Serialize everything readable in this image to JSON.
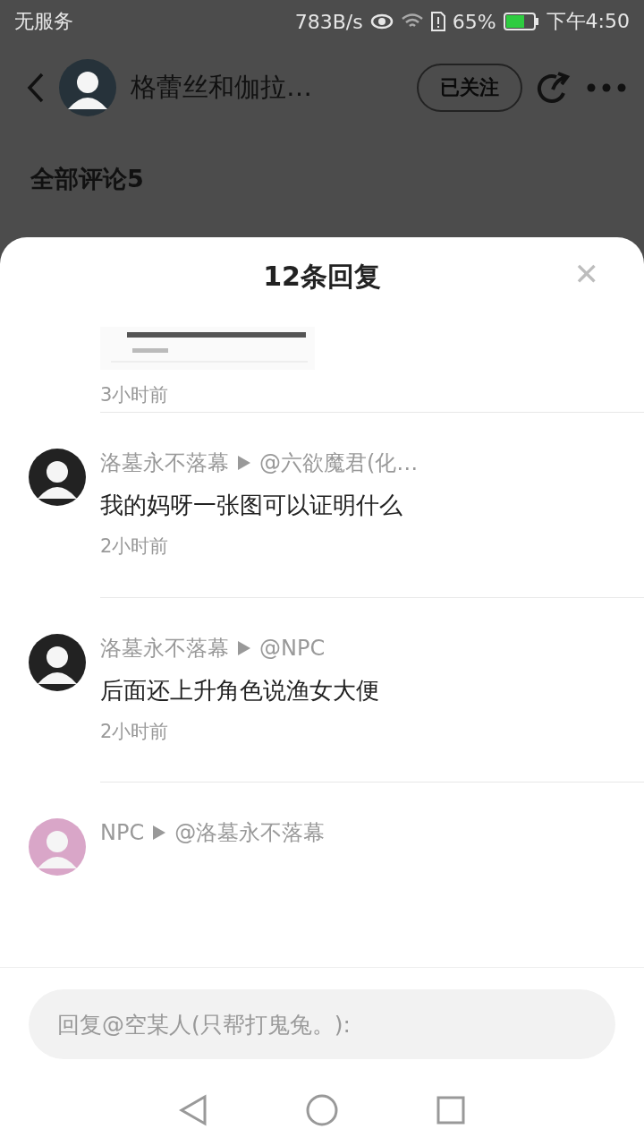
{
  "status_bar": {
    "carrier": "无服务",
    "speed": "783B/s",
    "battery": "65%",
    "time": "下午4:50"
  },
  "header": {
    "title": "格蕾丝和伽拉…",
    "follow_button": "已关注"
  },
  "section_title": "全部评论5",
  "sheet": {
    "title": "12条回复",
    "close": "✕",
    "top_time": "3小时前",
    "replies": [
      {
        "author": "洛墓永不落幕",
        "target": "@六欲魔君(化…",
        "text": "我的妈呀一张图可以证明什么",
        "time": "2小时前"
      },
      {
        "author": "洛墓永不落幕",
        "target": "@NPC",
        "text": "后面还上升角色说渔女大便",
        "time": "2小时前"
      },
      {
        "author": "NPC",
        "target": "@洛墓永不落幕"
      }
    ]
  },
  "reply_input": {
    "placeholder": "回复@空某人(只帮打鬼兔。):"
  }
}
